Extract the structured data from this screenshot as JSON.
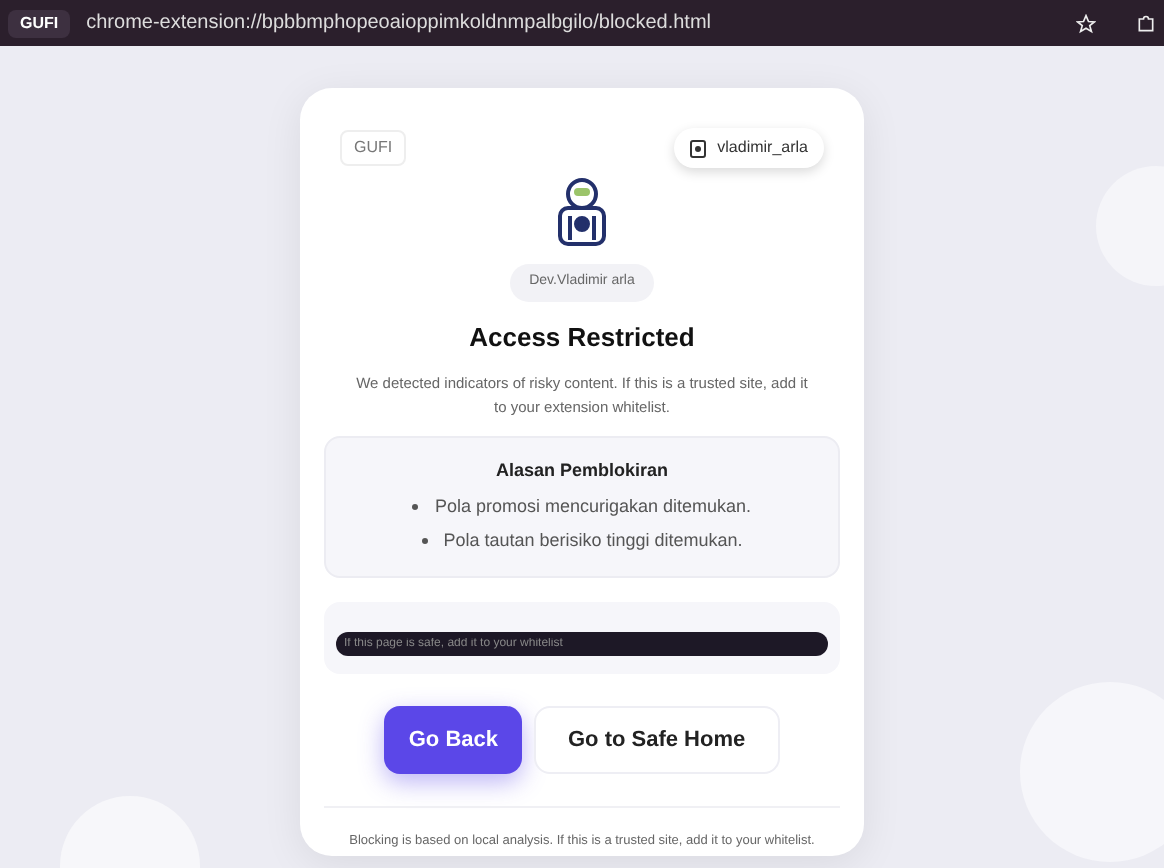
{
  "browser": {
    "tab_label": "GUFI",
    "address": "chrome-extension://bpbbmphopeoaioppimkoldnmpalbgilo/blocked.html"
  },
  "card": {
    "brand": "GUFI",
    "user_chip": "vladimir_arla",
    "dev_badge": "Dev.Vladimir arla",
    "title": "Access Restricted",
    "description": "We detected indicators of risky content. If this is a trusted site, add it to your extension whitelist.",
    "reasons": {
      "heading": "Alasan Pemblokiran",
      "items": [
        "Pola promosi mencurigakan ditemukan.",
        "Pola tautan berisiko tinggi ditemukan."
      ]
    },
    "whitelist_field": {
      "placeholder": "If this page is safe, add it to your whitelist"
    },
    "buttons": [
      {
        "label": "Go Back",
        "kind": "primary"
      },
      {
        "label": "Go to Safe Home",
        "kind": "secondary"
      }
    ],
    "footer": "Blocking is based on local analysis. If this is a trusted site, add it to your whitelist."
  }
}
